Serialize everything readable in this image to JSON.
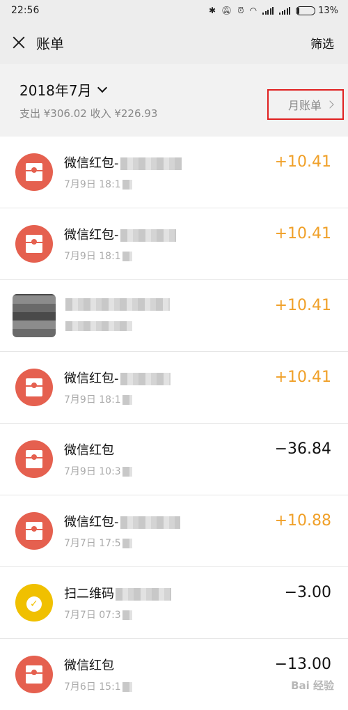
{
  "status_bar": {
    "time": "22:56",
    "battery": "13%"
  },
  "header": {
    "title": "账单",
    "filter_label": "筛选"
  },
  "summary": {
    "month": "2018年7月",
    "totals": "支出 ¥306.02 收入 ¥226.93",
    "monthly_bill_label": "月账单"
  },
  "transactions": [
    {
      "name": "微信红包-",
      "date": "7月9日 18:1",
      "amount": "+10.41",
      "icon": "red-envelope-icon"
    },
    {
      "name": "微信红包-",
      "date": "7月9日 18:1",
      "amount": "+10.41",
      "icon": "red-envelope-icon"
    },
    {
      "name": "",
      "date": "",
      "amount": "+10.41",
      "icon": "blurred-avatar"
    },
    {
      "name": "微信红包-",
      "date": "7月9日 18:1",
      "amount": "+10.41",
      "icon": "red-envelope-icon"
    },
    {
      "name": "微信红包",
      "date": "7月9日 10:3",
      "amount": "−36.84",
      "icon": "red-envelope-icon"
    },
    {
      "name": "微信红包-",
      "date": "7月7日 17:5",
      "amount": "+10.88",
      "icon": "red-envelope-icon"
    },
    {
      "name": "扫二维码",
      "date": "7月7日 07:3",
      "amount": "−3.00",
      "icon": "money-bag-icon"
    },
    {
      "name": "微信红包",
      "date": "7月6日 15:1",
      "amount": "−13.00",
      "icon": "red-envelope-icon"
    }
  ],
  "watermark": "Bai 经验",
  "colors": {
    "income": "#f0a028",
    "envelope": "#e5604f",
    "qr": "#f0c000",
    "highlight_box": "#e02020"
  }
}
